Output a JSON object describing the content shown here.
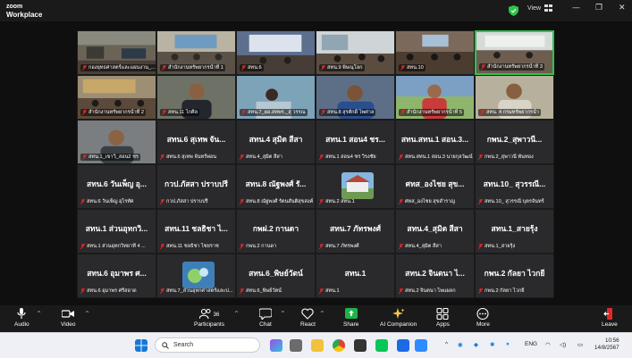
{
  "app": {
    "logo_line1": "zoom",
    "logo_line2": "Workplace",
    "view_label": "View"
  },
  "window_controls": [
    "—",
    "❐",
    "✕"
  ],
  "tiles": [
    {
      "type": "video",
      "name": "กองยุทธศาสตร์และแผนงาน_...",
      "scene": "room1"
    },
    {
      "type": "video",
      "name": "สำนักงานทรัพยากรน้ำที่ 1",
      "scene": "room2"
    },
    {
      "type": "video",
      "name": "สทน.6",
      "scene": "room3"
    },
    {
      "type": "video",
      "name": "สทน.9 พิษณุโลก",
      "scene": "room4"
    },
    {
      "type": "video",
      "name": "สทน.10",
      "scene": "room5"
    },
    {
      "type": "video",
      "name": "สำนักงานทรัพยากรน้ำที่ 3",
      "scene": "room6",
      "active": true
    },
    {
      "type": "video",
      "name": "สำนักงานทรัพยากรน้ำที่ 2",
      "scene": "room7"
    },
    {
      "type": "video",
      "name": "สทน.11 ไกศิล",
      "scene": "person1"
    },
    {
      "type": "video",
      "name": "สทน.7_ผอ.สทพร._สุ วรรณ",
      "scene": "person2"
    },
    {
      "type": "video",
      "name": "สทน.8 สุรศักดิ์ ไพศาล",
      "scene": "person3"
    },
    {
      "type": "video",
      "name": "สำนักงานทรัพยากรน้ำที่ 5",
      "scene": "person4"
    },
    {
      "type": "video",
      "name": "สทน. 4 กรมทรัพยากรน้ำ",
      "scene": "person5"
    },
    {
      "type": "video",
      "name": "สทน.1_เขาวิ_สอน2 ชร",
      "scene": "person6"
    },
    {
      "type": "name",
      "big": "สทน.6 สุเทพ จัน...",
      "name": "สทน.6 สุเทพ จันทร์พ่อน"
    },
    {
      "type": "name",
      "big": "สทน.4 สุมิต สีสา",
      "name": "สทน.4_สุมิต สีสา"
    },
    {
      "type": "name",
      "big": "สทน.1 สอน4 ชร...",
      "name": "สทน.1 สอน4 ชร วิรงชัย"
    },
    {
      "type": "name",
      "big": "สทน.สทน.1 สอน.3...",
      "name": "สทน.สทน.1 สอน.3 นายกุลวัฒน์"
    },
    {
      "type": "name",
      "big": "กพน.2_สุพาวนี...",
      "name": "กพน.2_สุพาวนี พันทอง"
    },
    {
      "type": "name",
      "big": "สทน.6 วันเพ็ญ อุ...",
      "name": "สทน.6 วันเพ็ญ อุไรทัศ"
    },
    {
      "type": "name",
      "big": "กวป.ภัสสา ปราบปรี",
      "name": "กวป.ภัสสา ปราบปรี"
    },
    {
      "type": "name",
      "big": "สทน.8 ณัฐพงศ์ รั...",
      "name": "สทน.8 ณัฐพงศ์ รัตนสันติสุขสงค์"
    },
    {
      "type": "avatar",
      "big": "",
      "name": "สทน.2 สทน.1",
      "scene": "house"
    },
    {
      "type": "name",
      "big": "ศทส_องไชย สุข...",
      "name": "ศทส_องไชย สุขสำราญ"
    },
    {
      "type": "name",
      "big": "สทน.10_ สุวรรณี...",
      "name": "สทน.10_ สุวรรณี บุตรจันทร์"
    },
    {
      "type": "name",
      "big": "สทน.1 ส่วนอุทกวิ...",
      "name": "สทน.1 ส่วนอุทกวิทยาที่ 4 ..."
    },
    {
      "type": "name",
      "big": "สทน.11 ชลธิชา ไ...",
      "name": "สทน.11 ชลธิชา ไชยราช"
    },
    {
      "type": "name",
      "big": "กพฝ.2 กานดา",
      "name": "กพน.2 กานดา"
    },
    {
      "type": "name",
      "big": "สทน.7 ภัทรพงศ์",
      "name": "สทน.7 ภัทรพงศ์"
    },
    {
      "type": "name",
      "big": "สทน.4_สุมิต สีสา",
      "name": "สทน.4_สุมิต สีสา"
    },
    {
      "type": "name",
      "big": "สทน.1_สายรุ้ง",
      "name": "สทน.1_สายรุ้ง"
    },
    {
      "type": "name",
      "big": "สทน.6 อุมาพร ศ...",
      "name": "สทน.6 อุมาพร ศรีสอาด"
    },
    {
      "type": "avatar",
      "big": "",
      "name": "สทน.7_ส่วนอุทกศาสตร์และป...",
      "scene": "nature"
    },
    {
      "type": "name",
      "big": "สทน.6_พิษย์วัตน์",
      "name": "สทน.6_พิษย์วัตน์"
    },
    {
      "type": "name",
      "big": "สทน.1",
      "name": "สทน.1"
    },
    {
      "type": "name",
      "big": "สทน.2 จินตนา ไ...",
      "name": "สทน.2 จินตนา ไพแผลก"
    },
    {
      "type": "name",
      "big": "กพน.2 กัลยา ไวกยี",
      "name": "กพน.2 กัลยา ไวกยี"
    }
  ],
  "toolbar": {
    "audio": "Audio",
    "video": "Video",
    "participants": "Participants",
    "participants_count": "36",
    "chat": "Chat",
    "react": "React",
    "share": "Share",
    "ai": "AI Companion",
    "apps": "Apps",
    "more": "More",
    "leave": "Leave"
  },
  "taskbar": {
    "search_placeholder": "Search",
    "lang": "ENG",
    "time": "10:56",
    "date": "14/8/2567"
  },
  "colors": {
    "active": "#2ec44b",
    "muted": "#e02828",
    "share": "#1fb24a",
    "leave": "#e02828"
  }
}
